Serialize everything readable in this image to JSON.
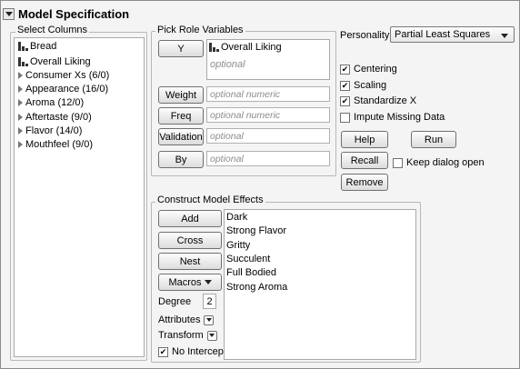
{
  "window": {
    "title": "Model Specification"
  },
  "select_columns": {
    "label": "Select Columns",
    "items": [
      {
        "label": "Bread",
        "kind": "bar-chart-icon"
      },
      {
        "label": "Overall Liking",
        "kind": "bar-chart-icon"
      },
      {
        "label": "Consumer Xs (6/0)",
        "kind": "collapsed-group"
      },
      {
        "label": "Appearance (16/0)",
        "kind": "collapsed-group"
      },
      {
        "label": "Aroma (12/0)",
        "kind": "collapsed-group"
      },
      {
        "label": "Aftertaste (9/0)",
        "kind": "collapsed-group"
      },
      {
        "label": "Flavor (14/0)",
        "kind": "collapsed-group"
      },
      {
        "label": "Mouthfeel (9/0)",
        "kind": "collapsed-group"
      }
    ]
  },
  "pick_role": {
    "label": "Pick Role Variables",
    "y_button": "Y",
    "y_value": "Overall Liking",
    "y_placeholder": "optional",
    "weight_button": "Weight",
    "weight_placeholder": "optional numeric",
    "freq_button": "Freq",
    "freq_placeholder": "optional numeric",
    "validation_button": "Validation",
    "validation_placeholder": "optional",
    "by_button": "By",
    "by_placeholder": "optional"
  },
  "personality": {
    "label": "Personality:",
    "value": "Partial Least Squares"
  },
  "options": {
    "centering": {
      "label": "Centering",
      "checked": true
    },
    "scaling": {
      "label": "Scaling",
      "checked": true
    },
    "standardize": {
      "label": "Standardize X",
      "checked": true
    },
    "impute": {
      "label": "Impute Missing Data",
      "checked": false
    },
    "keep_open": {
      "label": "Keep dialog open",
      "checked": false
    }
  },
  "action_buttons": {
    "help": "Help",
    "run": "Run",
    "recall": "Recall",
    "remove": "Remove"
  },
  "construct": {
    "label": "Construct Model Effects",
    "add": "Add",
    "cross": "Cross",
    "nest": "Nest",
    "macros": "Macros",
    "degree_label": "Degree",
    "degree_value": "2",
    "attributes_label": "Attributes",
    "transform_label": "Transform",
    "no_intercept_label": "No Intercept",
    "no_intercept_checked": true,
    "effects": [
      "Dark",
      "Strong Flavor",
      "Gritty",
      "Succulent",
      "Full Bodied",
      "Strong Aroma"
    ]
  },
  "colors": {
    "background": "#f4f4f4",
    "group_border": "#b7b7b7",
    "list_bg": "#ffffff"
  }
}
